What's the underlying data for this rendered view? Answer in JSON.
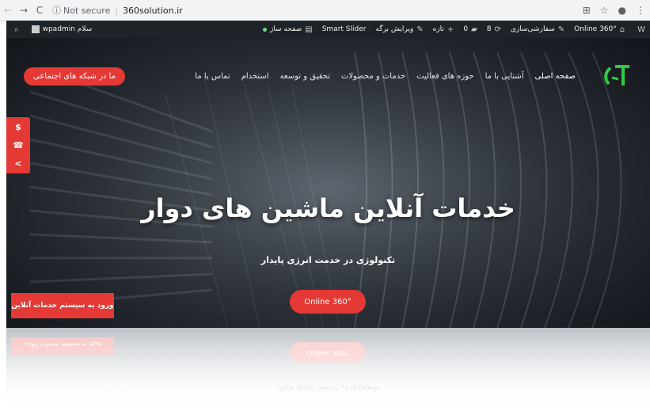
{
  "browser": {
    "back": "←",
    "forward": "→",
    "reload": "C",
    "secure_label": "Not secure",
    "url": "360solution.ir"
  },
  "admin_bar": {
    "wp_logo": "W",
    "site_name": "Online 360°",
    "customize": "سفارشی‌سازی",
    "updates": "8",
    "comments": "0",
    "new": "تازه",
    "edit_page": "ویرایش برگه",
    "smart_slider": "Smart Slider",
    "page_builder": "صفحه ساز",
    "greeting": "سلام",
    "username": "wpadmin"
  },
  "nav": {
    "items": [
      "صفحه اصلی",
      "آشنایی با ما",
      "حوزه های فعالیت",
      "خدمات و محصولات",
      "تحقیق و توسعه",
      "استخدام",
      "تماس با ما"
    ],
    "social_button": "ما در شبکه های اجتماعی"
  },
  "side_tabs": [
    "$",
    "☎",
    "<"
  ],
  "hero": {
    "title": "خدمات آنلاین ماشین های دوار",
    "subtitle": "تکنولوژی در خدمت انرژی پایدار",
    "cta": "Online 360°",
    "login_button": "ورود به سیستم خدمات آنلاین"
  },
  "colors": {
    "accent": "#e53935",
    "admin_bar": "#1d2327",
    "logo_green": "#2ecc40"
  }
}
